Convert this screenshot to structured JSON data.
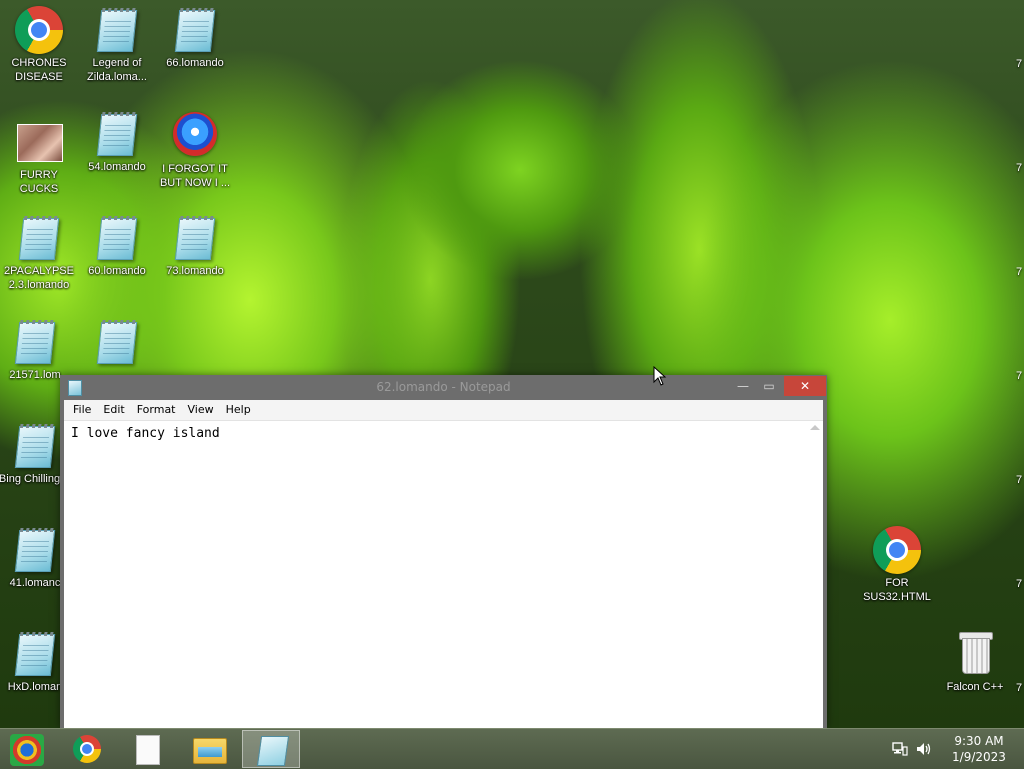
{
  "desktop": {
    "icons": [
      {
        "label": "CHRONES DISEASE",
        "icon": "chrome-icon"
      },
      {
        "label": "Legend of Zilda.loma...",
        "icon": "notepad-file-icon"
      },
      {
        "label": "66.lomando",
        "icon": "notepad-file-icon"
      },
      {
        "label": "FURRY CUCKS",
        "icon": "image-file-icon"
      },
      {
        "label": "54.lomando",
        "icon": "notepad-file-icon"
      },
      {
        "label": "I FORGOT IT BUT NOW I ...",
        "icon": "gem-app-icon"
      },
      {
        "label": "2PACALYPSE 2.3.lomando",
        "icon": "notepad-file-icon"
      },
      {
        "label": "60.lomando",
        "icon": "notepad-file-icon"
      },
      {
        "label": "73.lomando",
        "icon": "notepad-file-icon"
      },
      {
        "label": "21571.lom",
        "icon": "notepad-file-icon"
      },
      {
        "label": "",
        "icon": "notepad-file-icon"
      },
      {
        "label": "Bing Chilling.lc",
        "icon": "notepad-file-icon"
      },
      {
        "label": "41.lomanc",
        "icon": "notepad-file-icon"
      },
      {
        "label": "HxD.loman",
        "icon": "notepad-file-icon"
      },
      {
        "label": "FOR SUS32.HTML",
        "icon": "chrome-icon"
      },
      {
        "label": "Falcon C++",
        "icon": "recycle-bin-icon"
      }
    ],
    "right_edge_chars": [
      "7",
      "7",
      "7",
      "7",
      "7",
      "7",
      "7"
    ]
  },
  "notepad": {
    "title": "62.lomando - Notepad",
    "minimize": "—",
    "maximize": "▭",
    "close": "✕",
    "menu": [
      "File",
      "Edit",
      "Format",
      "View",
      "Help"
    ],
    "text": "I love fancy island"
  },
  "taskbar": {
    "buttons": [
      "start-icon",
      "chrome-icon",
      "file-icon",
      "file-explorer-icon",
      "notepad-icon"
    ],
    "tray": {
      "network_icon": "network-icon",
      "volume_icon": "volume-icon",
      "time": "9:30 AM",
      "date": "1/9/2023"
    }
  }
}
